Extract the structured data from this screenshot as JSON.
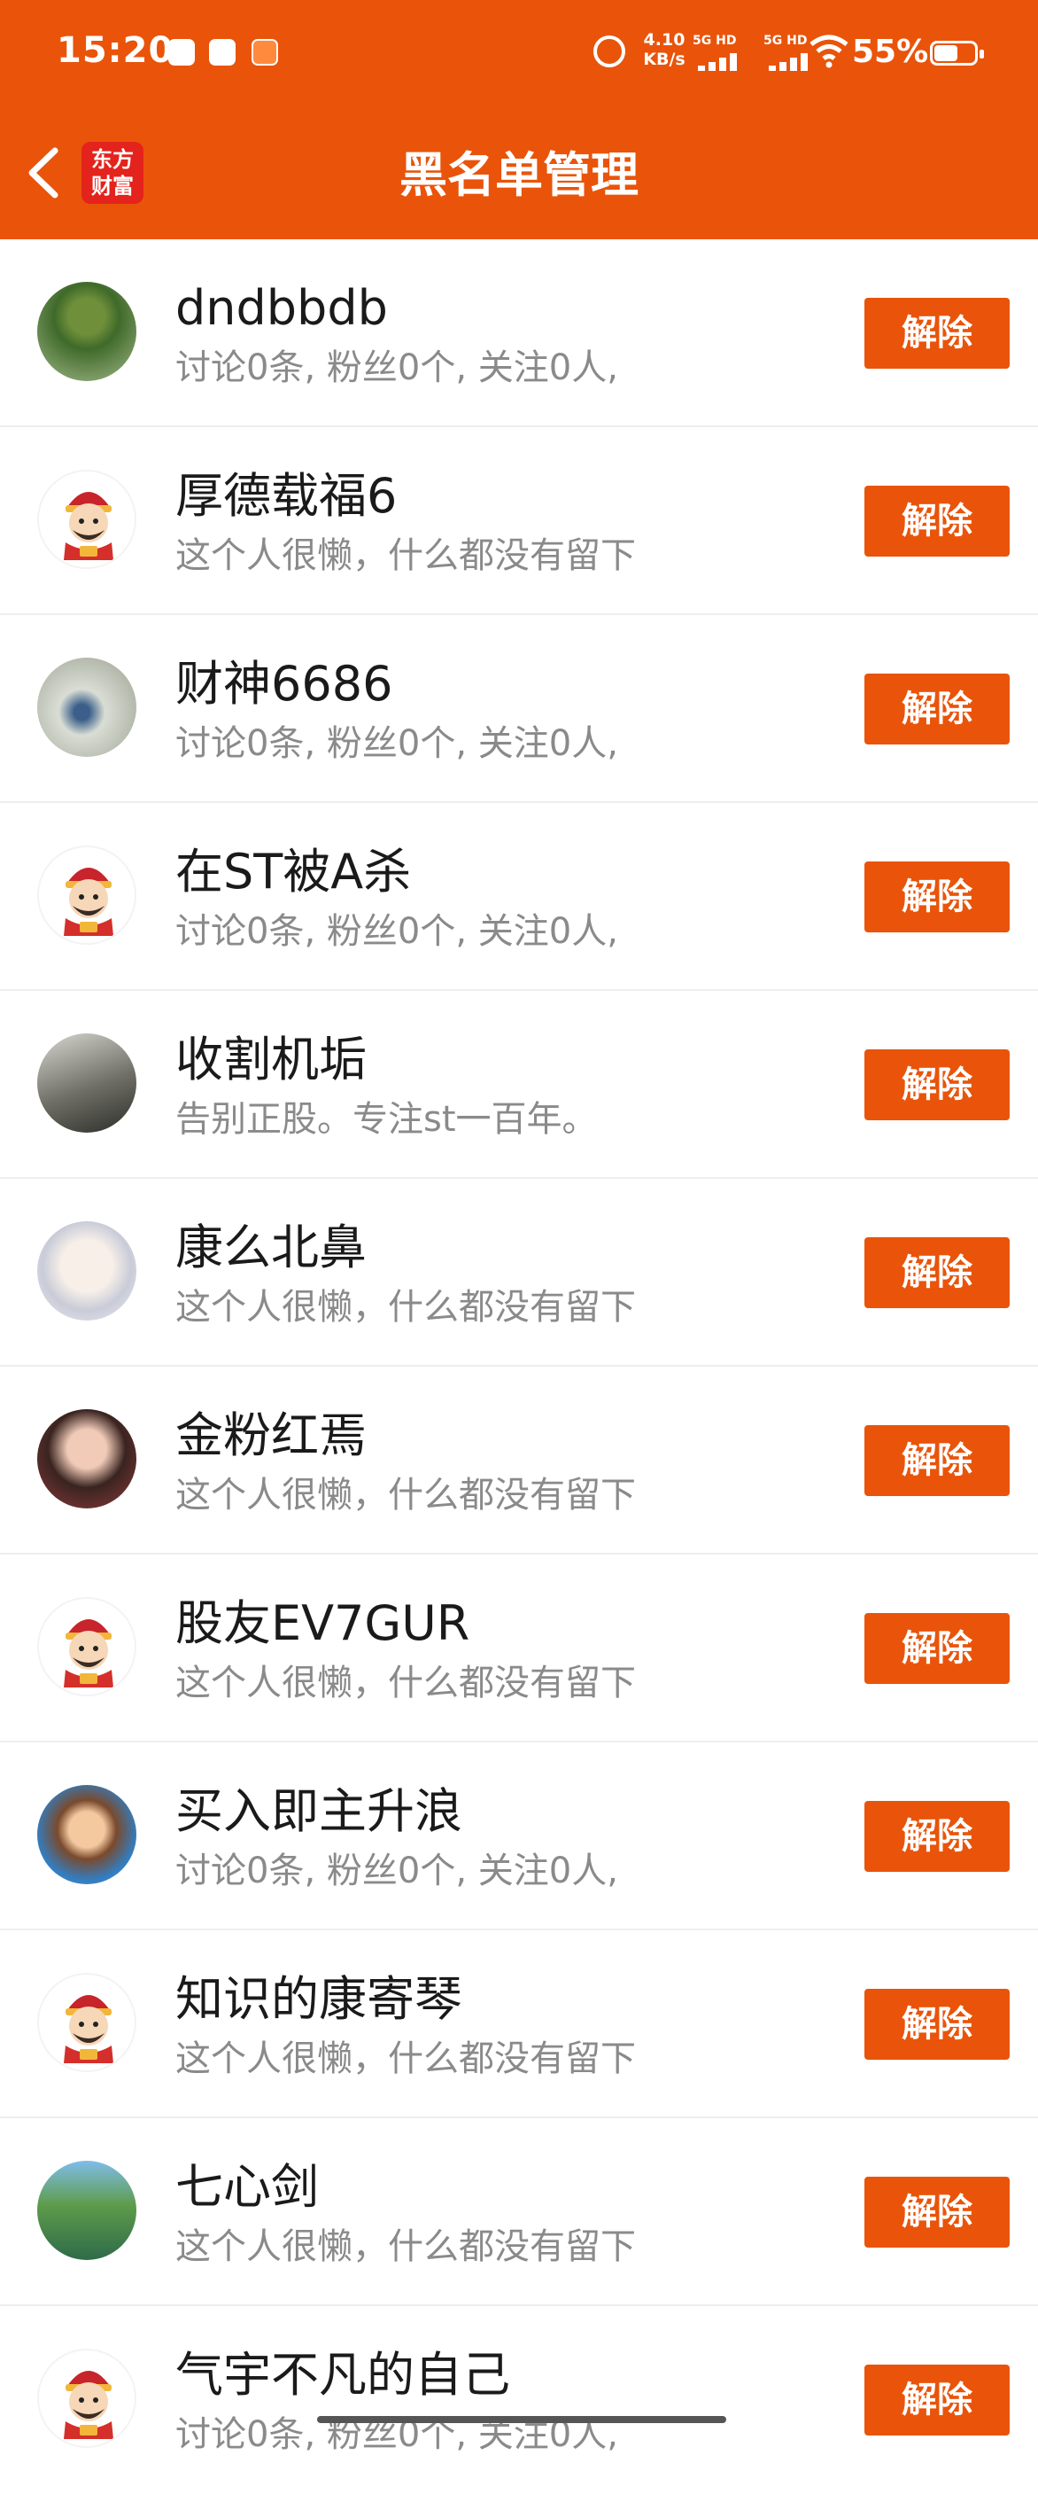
{
  "status_bar": {
    "time": "15:20",
    "net_speed_value": "4.10",
    "net_speed_unit": "KB/s",
    "signal_1": "5G HD",
    "signal_2": "5G HD",
    "battery": "55%"
  },
  "header": {
    "back_icon": "chevron-left-icon",
    "logo_line1": "东方",
    "logo_line2": "财富",
    "title": "黑名单管理"
  },
  "colors": {
    "accent": "#e9540a",
    "logo_red": "#e3231c",
    "desc_gray": "#8a8a8a"
  },
  "users": [
    {
      "name": "dndbbdb",
      "desc": "讨论0条, 粉丝0个, 关注0人,",
      "action": "解除"
    },
    {
      "name": "厚德载福6",
      "desc": "这个人很懒，什么都没有留下",
      "action": "解除"
    },
    {
      "name": "财神6686",
      "desc": "讨论0条, 粉丝0个, 关注0人,",
      "action": "解除"
    },
    {
      "name": "在ST被A杀",
      "desc": "讨论0条, 粉丝0个, 关注0人,",
      "action": "解除"
    },
    {
      "name": "收割机垢",
      "desc": "告别正股。专注st一百年。",
      "action": "解除"
    },
    {
      "name": "康么北鼻",
      "desc": "这个人很懒，什么都没有留下",
      "action": "解除"
    },
    {
      "name": "金粉红焉",
      "desc": "这个人很懒，什么都没有留下",
      "action": "解除"
    },
    {
      "name": "股友EV7GUR",
      "desc": "这个人很懒，什么都没有留下",
      "action": "解除"
    },
    {
      "name": "买入即主升浪",
      "desc": "讨论0条, 粉丝0个, 关注0人,",
      "action": "解除"
    },
    {
      "name": "知识的康寄琴",
      "desc": "这个人很懒，什么都没有留下",
      "action": "解除"
    },
    {
      "name": "七心剑",
      "desc": "这个人很懒，什么都没有留下",
      "action": "解除"
    },
    {
      "name": "气宇不凡的自己",
      "desc": "讨论0条, 粉丝0个, 关注0人,",
      "action": "解除"
    }
  ]
}
